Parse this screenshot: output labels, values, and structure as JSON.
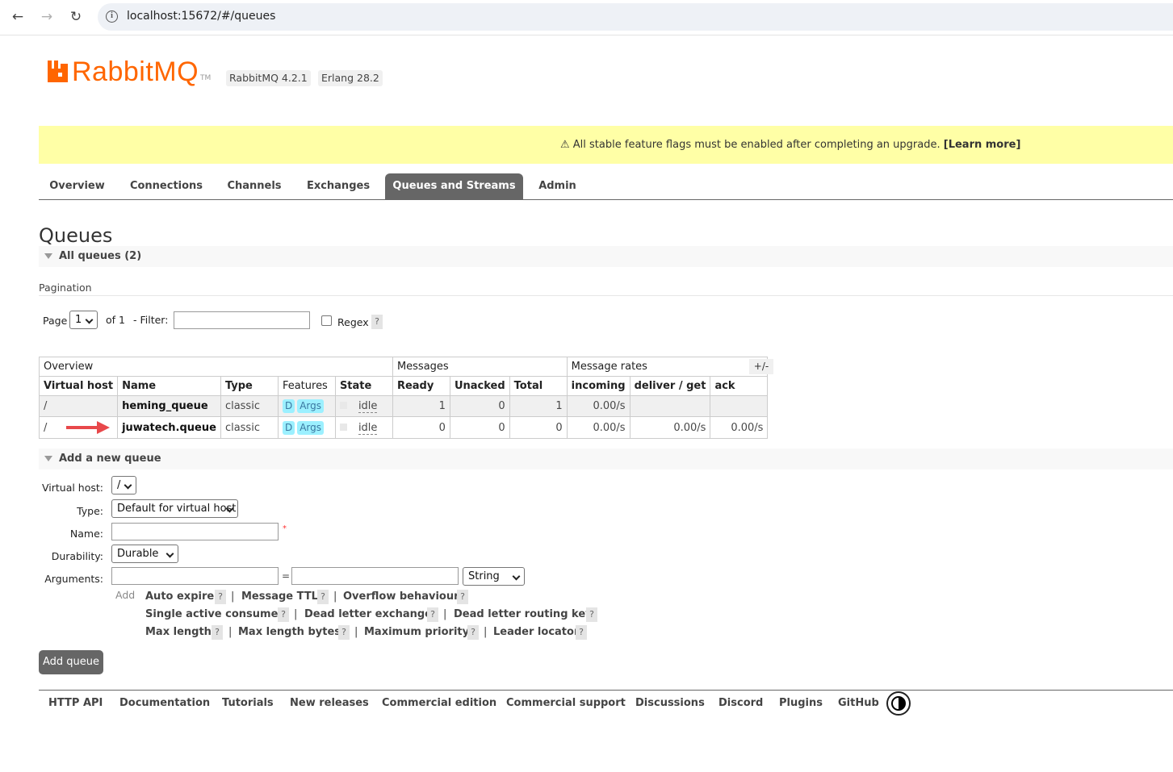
{
  "browser": {
    "url": "localhost:15672/#/queues",
    "back_icon": "←",
    "forward_icon": "→",
    "reload_icon": "↻"
  },
  "header": {
    "logo_text": "RabbitMQ",
    "logo_tm": "TM",
    "version_badge": "RabbitMQ 4.2.1",
    "erlang_badge": "Erlang 28.2",
    "brand_color": "#ff6600"
  },
  "banner": {
    "text": "⚠ All stable feature flags must be enabled after completing an upgrade.",
    "link": "[Learn more]",
    "bg_color": "#ffffa6"
  },
  "tabs": [
    {
      "label": "Overview"
    },
    {
      "label": "Connections"
    },
    {
      "label": "Channels"
    },
    {
      "label": "Exchanges"
    },
    {
      "label": "Queues and Streams",
      "active": true
    },
    {
      "label": "Admin"
    }
  ],
  "page": {
    "title": "Queues",
    "all_queues_header": "All queues (2)"
  },
  "pagination": {
    "section_label": "Pagination",
    "page_label": "Page",
    "page_value": "1",
    "of_label": "of 1",
    "filter_label": "- Filter:",
    "filter_value": "",
    "regex_label": "Regex",
    "help": "?"
  },
  "table": {
    "groups": [
      "Overview",
      "Messages",
      "Message rates"
    ],
    "columns": [
      "Virtual host",
      "Name",
      "Type",
      "Features",
      "State",
      "Ready",
      "Unacked",
      "Total",
      "incoming",
      "deliver / get",
      "ack"
    ],
    "toggle_columns": "+/-",
    "rows": [
      {
        "vhost": "/",
        "name": "heming_queue",
        "type": "classic",
        "feat_d": "D",
        "feat_args": "Args",
        "state": "idle",
        "ready": "1",
        "unacked": "0",
        "total": "1",
        "incoming": "0.00/s",
        "deliver": "",
        "ack": ""
      },
      {
        "vhost": "/",
        "name": "juwatech.queue",
        "type": "classic",
        "feat_d": "D",
        "feat_args": "Args",
        "state": "idle",
        "ready": "0",
        "unacked": "0",
        "total": "0",
        "incoming": "0.00/s",
        "deliver": "0.00/s",
        "ack": "0.00/s"
      }
    ]
  },
  "add_queue": {
    "header": "Add a new queue",
    "vhost_label": "Virtual host:",
    "vhost_value": "/",
    "type_label": "Type:",
    "type_value": "Default for virtual host",
    "name_label": "Name:",
    "name_value": "",
    "required_mark": "*",
    "durability_label": "Durability:",
    "durability_value": "Durable",
    "arguments_label": "Arguments:",
    "arg_key": "",
    "eq": "=",
    "arg_value": "",
    "arg_type": "String",
    "add_label": "Add",
    "arg_links": [
      [
        "Auto expire",
        "Message TTL",
        "Overflow behaviour"
      ],
      [
        "Single active consumer",
        "Dead letter exchange",
        "Dead letter routing key"
      ],
      [
        "Max length",
        "Max length bytes",
        "Maximum priority",
        "Leader locator"
      ]
    ],
    "help": "?",
    "pipe": "|",
    "submit": "Add queue"
  },
  "footer": {
    "links": [
      "HTTP API",
      "Documentation",
      "Tutorials",
      "New releases",
      "Commercial edition",
      "Commercial support",
      "Discussions",
      "Discord",
      "Plugins",
      "GitHub"
    ]
  }
}
